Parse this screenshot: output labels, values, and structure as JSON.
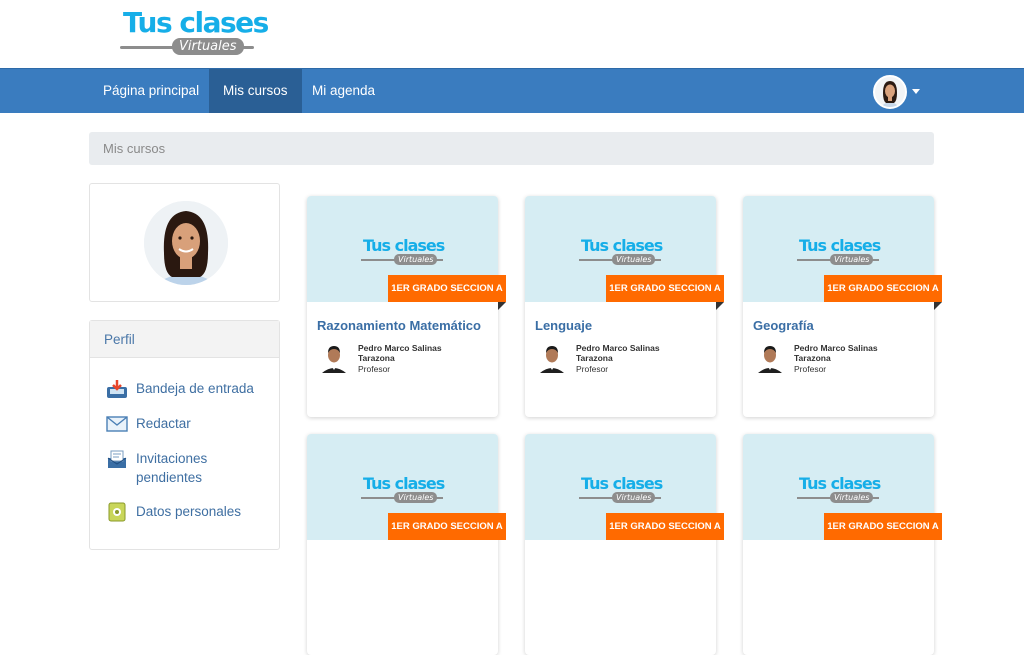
{
  "brand": {
    "logo_main": "Tus clases",
    "logo_sub": "Virtuales"
  },
  "nav": {
    "items": [
      {
        "label": "Página principal",
        "active": false
      },
      {
        "label": "Mis cursos",
        "active": true
      },
      {
        "label": "Mi agenda",
        "active": false
      }
    ]
  },
  "breadcrumb": {
    "label": "Mis cursos"
  },
  "sidebar": {
    "panel_title": "Perfil",
    "items": [
      {
        "label": "Bandeja de entrada",
        "icon": "inbox-icon"
      },
      {
        "label": "Redactar",
        "icon": "envelope-icon"
      },
      {
        "label": "Invitaciones pendientes",
        "icon": "invitation-icon"
      },
      {
        "label": "Datos personales",
        "icon": "personal-data-icon"
      }
    ]
  },
  "courses": [
    {
      "section": "1ER GRADO SECCION A",
      "title": "Razonamiento Matemático",
      "teacher": "Pedro Marco Salinas Tarazona",
      "role": "Profesor"
    },
    {
      "section": "1ER GRADO SECCION A",
      "title": "Lenguaje",
      "teacher": "Pedro Marco Salinas Tarazona",
      "role": "Profesor"
    },
    {
      "section": "1ER GRADO SECCION A",
      "title": "Geografía",
      "teacher": "Pedro Marco Salinas Tarazona",
      "role": "Profesor"
    },
    {
      "section": "1ER GRADO SECCION A"
    },
    {
      "section": "1ER GRADO SECCION A"
    },
    {
      "section": "1ER GRADO SECCION A"
    }
  ],
  "colors": {
    "navbar": "#3a7cbf",
    "nav_active": "#2a5f95",
    "accent_orange": "#ff6a00",
    "logo_blue": "#16aee8",
    "card_top": "#d6edf3",
    "link_blue": "#3a6ea5"
  }
}
